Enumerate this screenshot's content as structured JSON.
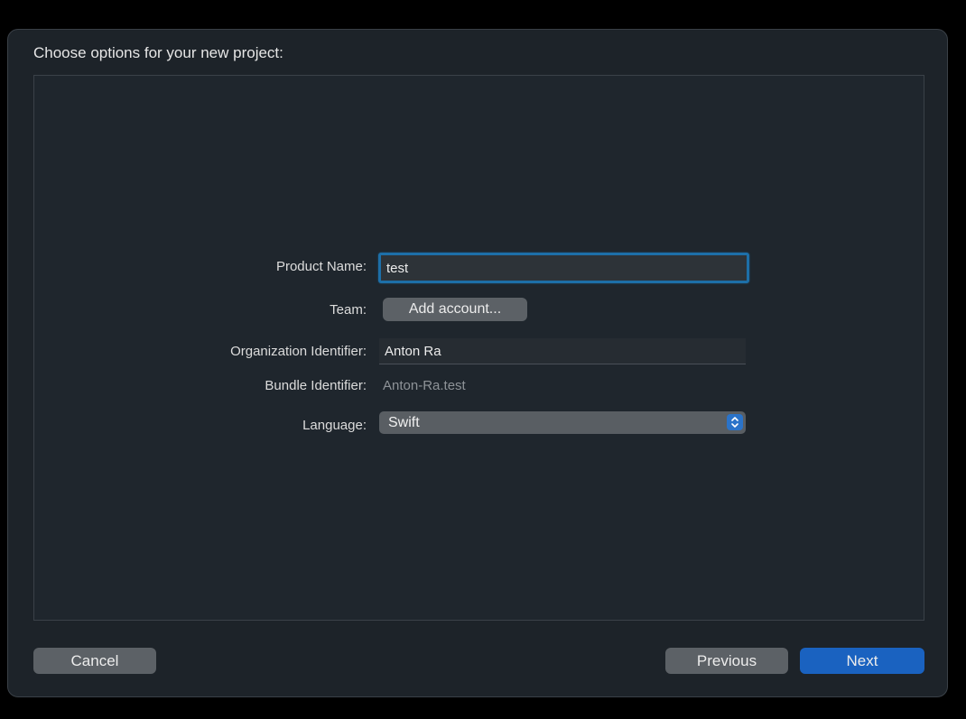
{
  "header": {
    "title": "Choose options for your new project:"
  },
  "form": {
    "product_name": {
      "label": "Product Name:",
      "value": "test"
    },
    "team": {
      "label": "Team:",
      "button_label": "Add account..."
    },
    "organization_identifier": {
      "label": "Organization Identifier:",
      "value": "Anton Ra"
    },
    "bundle_identifier": {
      "label": "Bundle Identifier:",
      "value": "Anton-Ra.test"
    },
    "language": {
      "label": "Language:",
      "selected": "Swift",
      "icon": "chevron-up-down-icon"
    }
  },
  "footer": {
    "cancel_label": "Cancel",
    "previous_label": "Previous",
    "next_label": "Next"
  },
  "colors": {
    "focus_ring": "#1d6fa8",
    "accent_button": "#1a62c0",
    "popup_indicator": "#2a73c9"
  }
}
